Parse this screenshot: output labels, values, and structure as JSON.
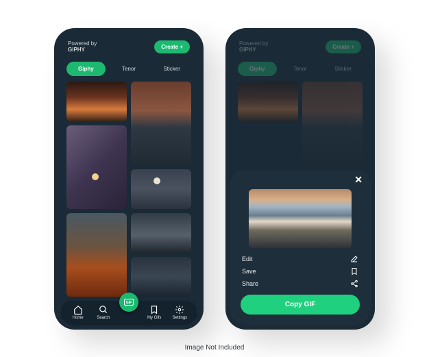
{
  "colors": {
    "bg": "#1a2a36",
    "accent": "#1db971",
    "accent_light": "#1fd07e"
  },
  "header": {
    "powered_label": "Powered by",
    "powered_brand": "GIPHY",
    "create_label": "Create +"
  },
  "source_tabs": [
    {
      "label": "Giphy",
      "active": true
    },
    {
      "label": "Tenor",
      "active": false
    },
    {
      "label": "Sticker",
      "active": false
    }
  ],
  "grid": {
    "items": [
      {
        "name": "sunset-gradient"
      },
      {
        "name": "mountain-dusk"
      },
      {
        "name": "purple-horizon-moon"
      },
      {
        "name": "moon-over-peaks"
      },
      {
        "name": "autumn-forest"
      },
      {
        "name": "dark-mountains-a"
      },
      {
        "name": "dark-mountains-b"
      }
    ]
  },
  "nav": {
    "items": [
      {
        "label": "Home",
        "icon": "home"
      },
      {
        "label": "Search",
        "icon": "search"
      },
      {
        "label": "",
        "icon": "gif-fab"
      },
      {
        "label": "My Gifs",
        "icon": "bookmark"
      },
      {
        "label": "Settings",
        "icon": "gear"
      }
    ]
  },
  "sheet": {
    "close_label": "✕",
    "preview": "winter-sunset",
    "actions": [
      {
        "label": "Edit",
        "icon": "edit"
      },
      {
        "label": "Save",
        "icon": "bookmark"
      },
      {
        "label": "Share",
        "icon": "share"
      }
    ],
    "copy_label": "Copy GIF"
  },
  "footnote": "Image Not Included"
}
